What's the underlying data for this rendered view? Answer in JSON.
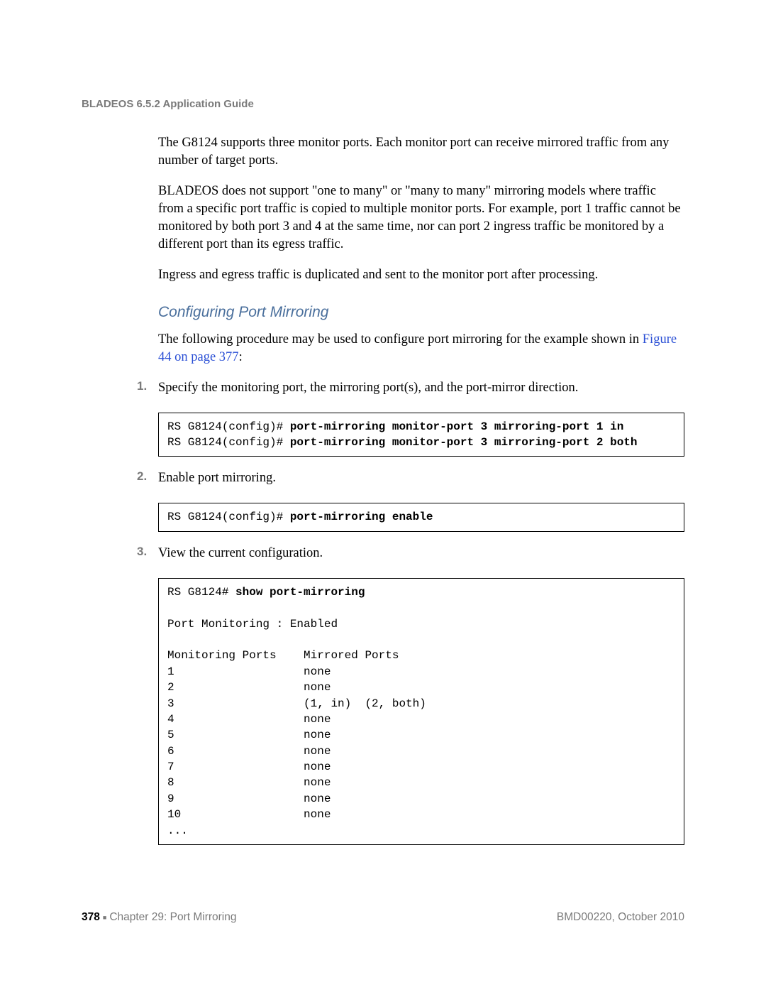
{
  "header": "BLADEOS 6.5.2 Application Guide",
  "para1": "The G8124 supports three monitor ports. Each monitor port can receive mirrored traffic from any number of target ports.",
  "para2": "BLADEOS does not support \"one to many\" or \"many to many\" mirroring models where traffic from a specific port traffic is copied to multiple monitor ports. For example, port 1 traffic cannot be monitored by both port 3 and 4 at the same time, nor can port 2 ingress traffic be monitored by a different port than its egress traffic.",
  "para3": "Ingress and egress traffic is duplicated and sent to the monitor port after processing.",
  "section_title": "Configuring Port Mirroring",
  "intro_text": "The following procedure may be used to configure port mirroring for the example shown in ",
  "intro_link": "Figure 44 on page 377",
  "intro_colon": ":",
  "steps": {
    "s1": {
      "num": "1.",
      "text": "Specify the monitoring port, the mirroring port(s), and the port-mirror direction."
    },
    "s2": {
      "num": "2.",
      "text": "Enable port mirroring."
    },
    "s3": {
      "num": "3.",
      "text": "View the current configuration."
    }
  },
  "code1": {
    "l1p": "RS G8124(config)# ",
    "l1b": "port-mirroring monitor-port 3 mirroring-port 1 in",
    "l2p": "RS G8124(config)# ",
    "l2b": "port-mirroring monitor-port 3 mirroring-port 2 both"
  },
  "code2": {
    "l1p": "RS G8124(config)# ",
    "l1b": "port-mirroring enable"
  },
  "code3": {
    "l1p": "RS G8124# ",
    "l1b": "show port-mirroring",
    "rest": "\nPort Monitoring : Enabled\n\nMonitoring Ports    Mirrored Ports\n1                   none\n2                   none\n3                   (1, in)  (2, both)\n4                   none\n5                   none\n6                   none\n7                   none\n8                   none\n9                   none\n10                  none\n..."
  },
  "footer": {
    "page": "378",
    "chapter": "Chapter 29: Port Mirroring",
    "docid": "BMD00220, October 2010"
  }
}
